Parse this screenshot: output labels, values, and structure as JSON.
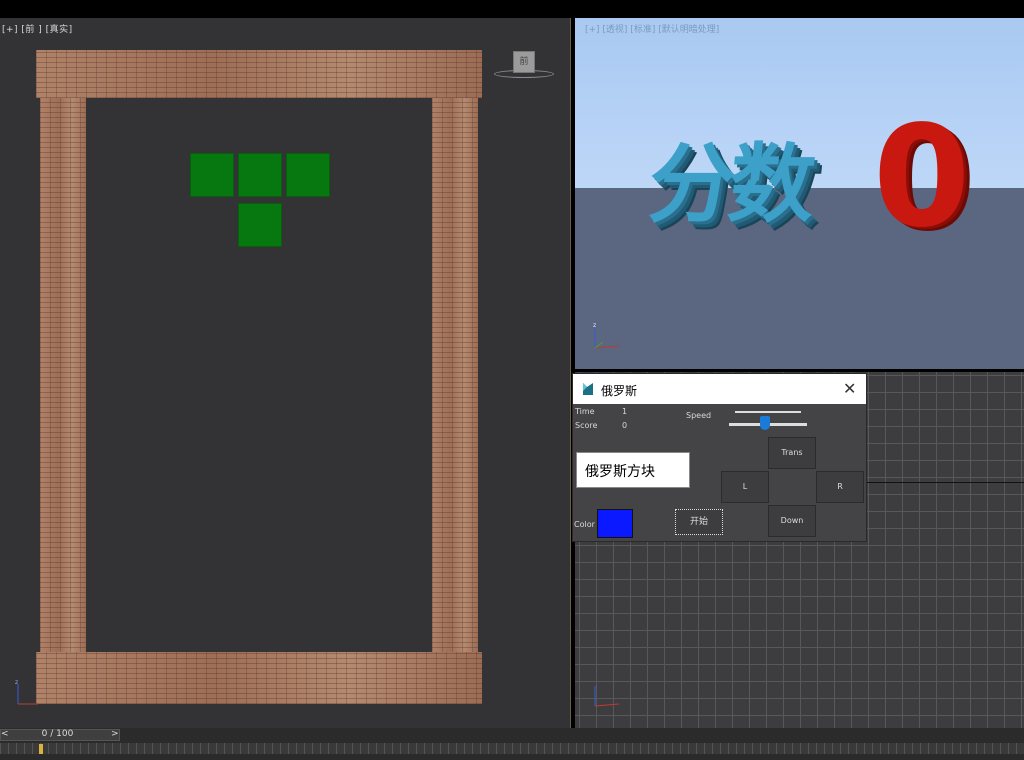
{
  "left_viewport": {
    "label": "[+] [前 ] [真实]",
    "nav_cube_label": "前"
  },
  "board_blocks": [
    {
      "col": 0,
      "row": 0
    },
    {
      "col": 1,
      "row": 0
    },
    {
      "col": 2,
      "row": 0
    },
    {
      "col": 1,
      "row": 1
    }
  ],
  "top_viewport": {
    "label": "[+] [透视] [标准] [默认明暗处理]",
    "score_word": "分数",
    "score_value": "0"
  },
  "timeline": {
    "frame_text": "0 / 100",
    "prev": "<",
    "next": ">"
  },
  "dialog": {
    "title": "俄罗斯",
    "time_label": "Time",
    "time_value": "1",
    "score_label": "Score",
    "score_value": "0",
    "speed_label": "Speed",
    "speed_value": 0.45,
    "game_name": "俄罗斯方块",
    "color_label": "Color",
    "color_value": "#0a19ff",
    "start_label": "开始",
    "trans_label": "Trans",
    "left_label": "L",
    "right_label": "R",
    "down_label": "Down"
  },
  "colors": {
    "piece": "#07780f",
    "score_word": "#3da0c8",
    "score_zero": "#c8180f"
  }
}
